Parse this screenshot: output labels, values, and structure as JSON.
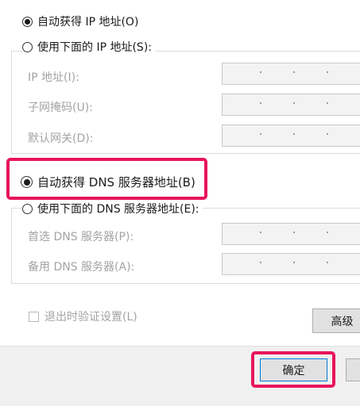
{
  "ip_section": {
    "auto_ip": {
      "label": "自动获得 IP 地址(O)",
      "selected": true
    },
    "manual_ip": {
      "label": "使用下面的 IP 地址(S):",
      "selected": false
    },
    "fields": [
      {
        "label": "IP 地址(I):"
      },
      {
        "label": "子网掩码(U):"
      },
      {
        "label": "默认网关(D):"
      }
    ]
  },
  "dns_section": {
    "auto_dns": {
      "label": "自动获得 DNS 服务器地址(B)",
      "selected": true
    },
    "manual_dns": {
      "label": "使用下面的 DNS 服务器地址(E):",
      "selected": false
    },
    "fields": [
      {
        "label": "首选 DNS 服务器(P):"
      },
      {
        "label": "备用 DNS 服务器(A):"
      }
    ]
  },
  "validate_on_exit": {
    "label": "退出时验证设置(L)",
    "checked": false
  },
  "buttons": {
    "advanced": "高级",
    "ok": "确定"
  },
  "colors": {
    "highlight": "#e8155a",
    "disabled_text": "#a3a3a3"
  }
}
